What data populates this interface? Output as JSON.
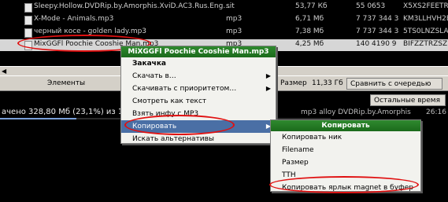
{
  "file_list": {
    "rows": [
      {
        "name": "Sleepy.Hollow.DVDRip.by.Amorphis.XviD.AC3.Rus.Eng…",
        "type": "sit",
        "size": "53,77 Кб",
        "count": "55 0653",
        "hash": "X5XS2FEETR…"
      },
      {
        "name": "X-Mode - Animals.mp3",
        "type": "mp3",
        "size": "6,71 Мб",
        "count": "7 737 344 3",
        "hash": "KM3LLHVH2EI…"
      },
      {
        "name": "черный косе - golden lady.mp3",
        "type": "mp3",
        "size": "7,38 Мб",
        "count": "7 737 344 3",
        "hash": "5TS0LNZSLA…"
      },
      {
        "name": "MixGGFl Poochie Cooshie Man.mp3",
        "type": "mp3",
        "size": "4,25 Мб",
        "count": "140 4190 9",
        "hash": "BIFZZTRZSZ…"
      }
    ]
  },
  "toolbar": {
    "label_left": "Элементы",
    "size_label": "Размер",
    "size_value": "11,33 Гб",
    "compare_button": "Сравнить с очередью",
    "right_button": "Остальные время"
  },
  "status": {
    "progress_text": "ачено 328,80 Мб (23,1%) из 1,4 Гб",
    "progress_fraction": 0.231,
    "right_text": "mp3 alloy DVDRip.by.Amorphis",
    "right_time": "26:16"
  },
  "context_menu": {
    "header": "MiXGGFl Poochie Cooshie Man.mp3",
    "items": [
      {
        "label": "Закачка",
        "bold": true,
        "arrow": false
      },
      {
        "label": "Скачать в…",
        "bold": false,
        "arrow": true
      },
      {
        "label": "Скачивать с приоритетом…",
        "bold": false,
        "arrow": true
      },
      {
        "label": "Смотреть как текст",
        "bold": false,
        "arrow": false
      },
      {
        "label": "Взять инфу с MP3",
        "bold": false,
        "arrow": false
      },
      {
        "label": "Копировать",
        "bold": false,
        "arrow": true,
        "highlighted": true
      },
      {
        "label": "Искать альтернативы",
        "bold": false,
        "arrow": false
      }
    ]
  },
  "submenu": {
    "header": "Копировать",
    "items": [
      {
        "label": "Копировать ник"
      },
      {
        "label": "Filename"
      },
      {
        "label": "Размер"
      },
      {
        "label": "TTH"
      },
      {
        "label": "Копировать ярлык magnet в буфер"
      }
    ]
  },
  "colors": {
    "menu_header_green": "#2f8a2f",
    "annotation_red": "#e01010",
    "highlight_blue": "#4a6fa5"
  },
  "icons": {
    "file": "file-icon",
    "arrow": "chevron-right-icon"
  }
}
